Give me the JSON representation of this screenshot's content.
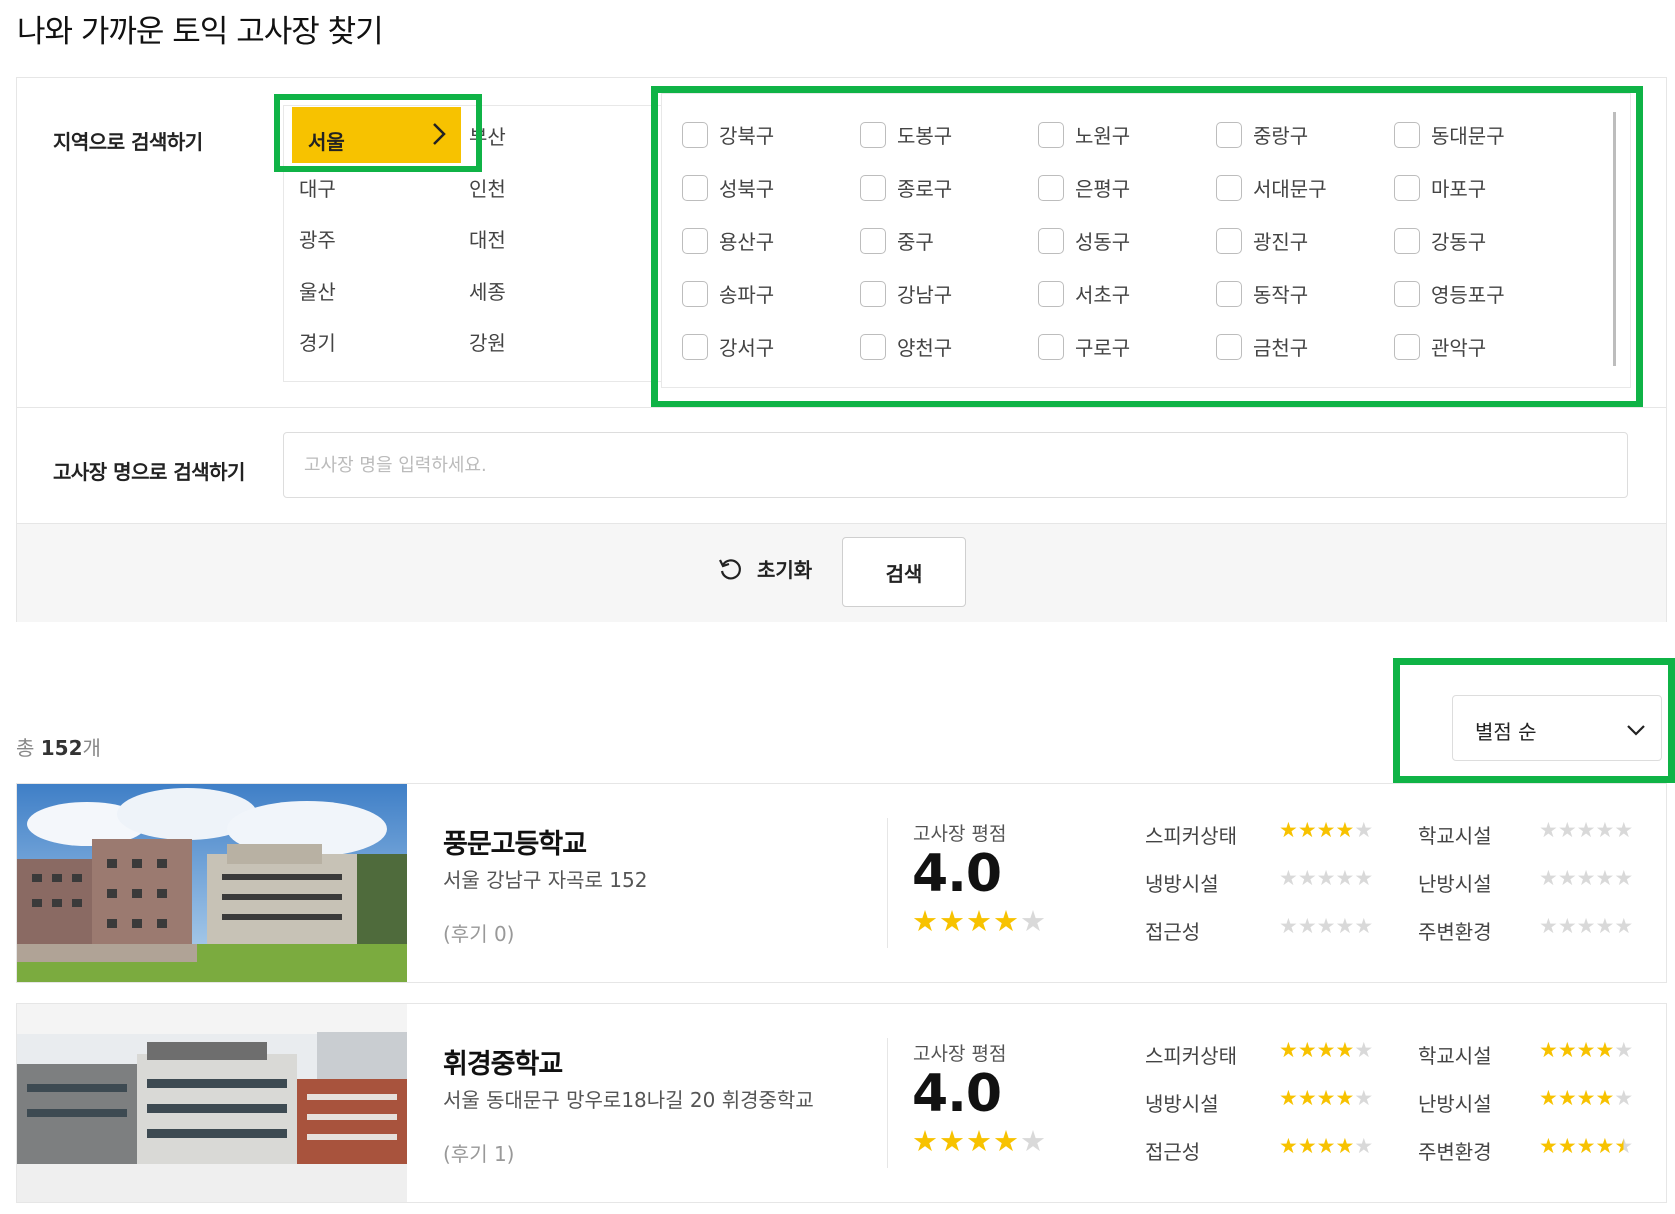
{
  "page_title": "나와 가까운 토익 고사장 찾기",
  "search": {
    "region_label": "지역으로 검색하기",
    "name_label": "고사장 명으로 검색하기",
    "name_placeholder": "고사장 명을 입력하세요.",
    "reset_label": "초기화",
    "search_label": "검색",
    "cities": [
      "서울",
      "부산",
      "대구",
      "인천",
      "광주",
      "대전",
      "울산",
      "세종",
      "경기",
      "강원"
    ],
    "selected_city": "서울",
    "districts": [
      "강북구",
      "도봉구",
      "노원구",
      "중랑구",
      "동대문구",
      "성북구",
      "종로구",
      "은평구",
      "서대문구",
      "마포구",
      "용산구",
      "중구",
      "성동구",
      "광진구",
      "강동구",
      "송파구",
      "강남구",
      "서초구",
      "동작구",
      "영등포구",
      "강서구",
      "양천구",
      "구로구",
      "금천구",
      "관악구"
    ]
  },
  "results": {
    "total_prefix": "총",
    "total_count": "152",
    "total_suffix": "개",
    "sort_value": "별점 순",
    "score_label": "고사장 평점",
    "attr_labels": [
      "스피커상태",
      "학교시설",
      "냉방시설",
      "난방시설",
      "접근성",
      "주변환경"
    ],
    "items": [
      {
        "name": "풍문고등학교",
        "address": "서울 강남구 자곡로 152",
        "reviews": "(후기 0)",
        "score": "4.0",
        "score_stars": 4,
        "attr_stars": [
          4,
          0,
          0,
          0,
          0,
          0
        ]
      },
      {
        "name": "휘경중학교",
        "address": "서울 동대문구 망우로18나길 20 휘경중학교",
        "reviews": "(후기 1)",
        "score": "4.0",
        "score_stars": 4,
        "attr_stars": [
          4,
          4,
          4,
          4,
          4,
          4.5
        ]
      }
    ]
  },
  "colors": {
    "accent_yellow": "#f7c200",
    "highlight_green": "#0fb346",
    "star_off": "#d9d9d9"
  },
  "icons": [
    "chevron-right-icon",
    "refresh-icon",
    "chevron-down-icon",
    "star-icon"
  ]
}
